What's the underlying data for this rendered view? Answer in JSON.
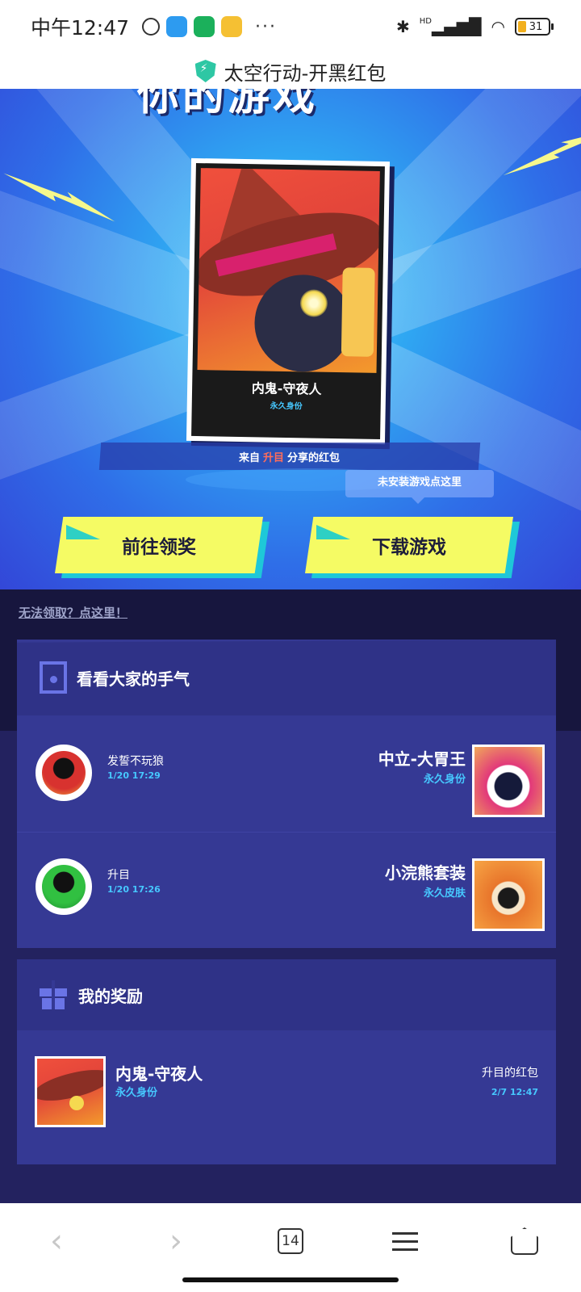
{
  "status_bar": {
    "time": "中午12:47",
    "dots": "···",
    "battery": "31",
    "signal_label": "HD"
  },
  "title_bar": {
    "title": "太空行动-开黑红包"
  },
  "hero": {
    "heading": "你的游戏",
    "card": {
      "name": "内鬼-守夜人",
      "subtitle": "永久身份"
    },
    "share": {
      "prefix": "来自",
      "sharer": "升目",
      "suffix": "分享的红包"
    },
    "tooltip": "未安装游戏点这里",
    "claim_button": "前往领奖",
    "download_button": "下载游戏"
  },
  "help_link": "无法领取？点这里！",
  "luck_panel": {
    "title": "看看大家的手气",
    "records": [
      {
        "user": "发誓不玩狼",
        "time": "1/20 17:29",
        "item": "中立-大胃王",
        "type": "永久身份"
      },
      {
        "user": "升目",
        "time": "1/20 17:26",
        "item": "小浣熊套装",
        "type": "永久皮肤"
      }
    ]
  },
  "reward_panel": {
    "title": "我的奖励",
    "reward": {
      "name": "内鬼-守夜人",
      "type": "永久身份",
      "from": "升目的红包",
      "time": "2/7 12:47"
    }
  },
  "bottom_nav": {
    "back": "‹",
    "forward": "›",
    "tab_count": "14"
  },
  "colors": {
    "accent_yellow": "#f5fb64",
    "accent_cyan": "#46c8ff",
    "panel": "#353994",
    "highlight": "#ff6d5a"
  }
}
